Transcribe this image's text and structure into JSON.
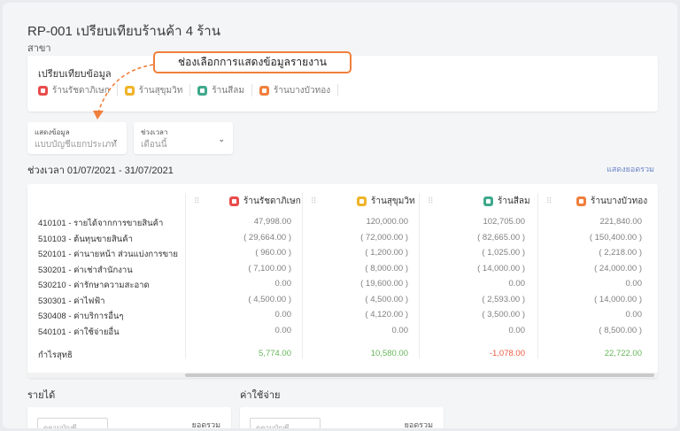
{
  "page": {
    "title": "RP-001 เปรียบเทียบร้านค้า 4 ร้าน",
    "branch_label": "สาขา"
  },
  "compare": {
    "title": "เปรียบเทียบข้อมูล",
    "stores": [
      {
        "name": "ร้านรัชดาภิเษก",
        "color": "#e94b4b"
      },
      {
        "name": "ร้านสุขุมวิท",
        "color": "#f0b429"
      },
      {
        "name": "ร้านสีลม",
        "color": "#3fa98c"
      },
      {
        "name": "ร้านบางบัวทอง",
        "color": "#f07f3c"
      }
    ]
  },
  "callout": {
    "text": "ช่องเลือกการแสดงข้อมูลรายงาน",
    "color": "#f07f3c"
  },
  "filters": {
    "display": {
      "label": "แสดงข้อมูล",
      "value": "แบบบัญชีแยกประเภท"
    },
    "period": {
      "label": "ช่วงเวลา",
      "value": "เดือนนี้"
    }
  },
  "period_text": "ช่วงเวลา 01/07/2021 - 31/07/2021",
  "show_total_link": "แสดงยอดรวม",
  "table": {
    "headers": [
      "ร้านรัชดาภิเษก",
      "ร้านสุขุมวิท",
      "ร้านสีลม",
      "ร้านบางบัวทอง"
    ],
    "rows": [
      {
        "label": "410101 - รายได้จากการขายสินค้า",
        "values": [
          "47,998.00",
          "120,000.00",
          "102,705.00",
          "221,840.00"
        ]
      },
      {
        "label": "510103 - ต้นทุนขายสินค้า",
        "values": [
          "( 29,664.00 )",
          "( 72,000.00 )",
          "( 82,665.00 )",
          "( 150,400.00 )"
        ]
      },
      {
        "label": "520101 - ค่านายหน้า ส่วนแบ่งการขาย",
        "values": [
          "( 960.00 )",
          "( 1,200.00 )",
          "( 1,025.00 )",
          "( 2,218.00 )"
        ]
      },
      {
        "label": "530201 - ค่าเช่าสำนักงาน",
        "values": [
          "( 7,100.00 )",
          "( 8,000.00 )",
          "( 14,000.00 )",
          "( 24,000.00 )"
        ]
      },
      {
        "label": "530210 - ค่ารักษาความสะอาด",
        "values": [
          "0.00",
          "( 19,600.00 )",
          "0.00",
          "0.00"
        ]
      },
      {
        "label": "530301 - ค่าไฟฟ้า",
        "values": [
          "( 4,500.00 )",
          "( 4,500.00 )",
          "( 2,593.00 )",
          "( 14,000.00 )"
        ]
      },
      {
        "label": "530408 - ค่าบริการอื่นๆ",
        "values": [
          "0.00",
          "( 4,120.00 )",
          "( 3,500.00 )",
          "0.00"
        ]
      },
      {
        "label": "540101 - ค่าใช้จ่ายอื่น",
        "values": [
          "0.00",
          "0.00",
          "0.00",
          "( 8,500.00 )"
        ]
      }
    ],
    "net": {
      "label": "กำไรสุทธิ",
      "values": [
        "5,774.00",
        "10,580.00",
        "-1,078.00",
        "22,722.00"
      ]
    }
  },
  "bottom": {
    "income_label": "รายได้",
    "expense_label": "ค่าใช้จ่าย",
    "income_total_label": "ยอดรวม",
    "expense_total_label": "ยอดรวม",
    "income_select": "ดูตามบัญชี",
    "expense_select": "ดูตามบัญชี"
  }
}
